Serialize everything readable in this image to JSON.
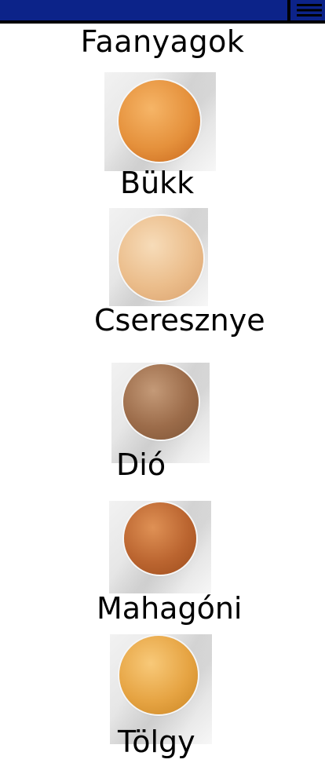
{
  "header": {
    "menu_icon": "hamburger-menu-icon",
    "bar_color": "#0c2389"
  },
  "page": {
    "title": "Faanyagok"
  },
  "woods": [
    {
      "label": "Bükk",
      "color_light": "#f0a24a",
      "color_dark": "#c8661b"
    },
    {
      "label": "Cseresznye",
      "color_light": "#f3cfa6",
      "color_dark": "#d9a06c"
    },
    {
      "label": "Dió",
      "color_light": "#b98a68",
      "color_dark": "#7d5436"
    },
    {
      "label": "Mahagóni",
      "color_light": "#d47f43",
      "color_dark": "#9c4c1c"
    },
    {
      "label": "Tölgy",
      "color_light": "#f4b85a",
      "color_dark": "#c98422"
    }
  ]
}
